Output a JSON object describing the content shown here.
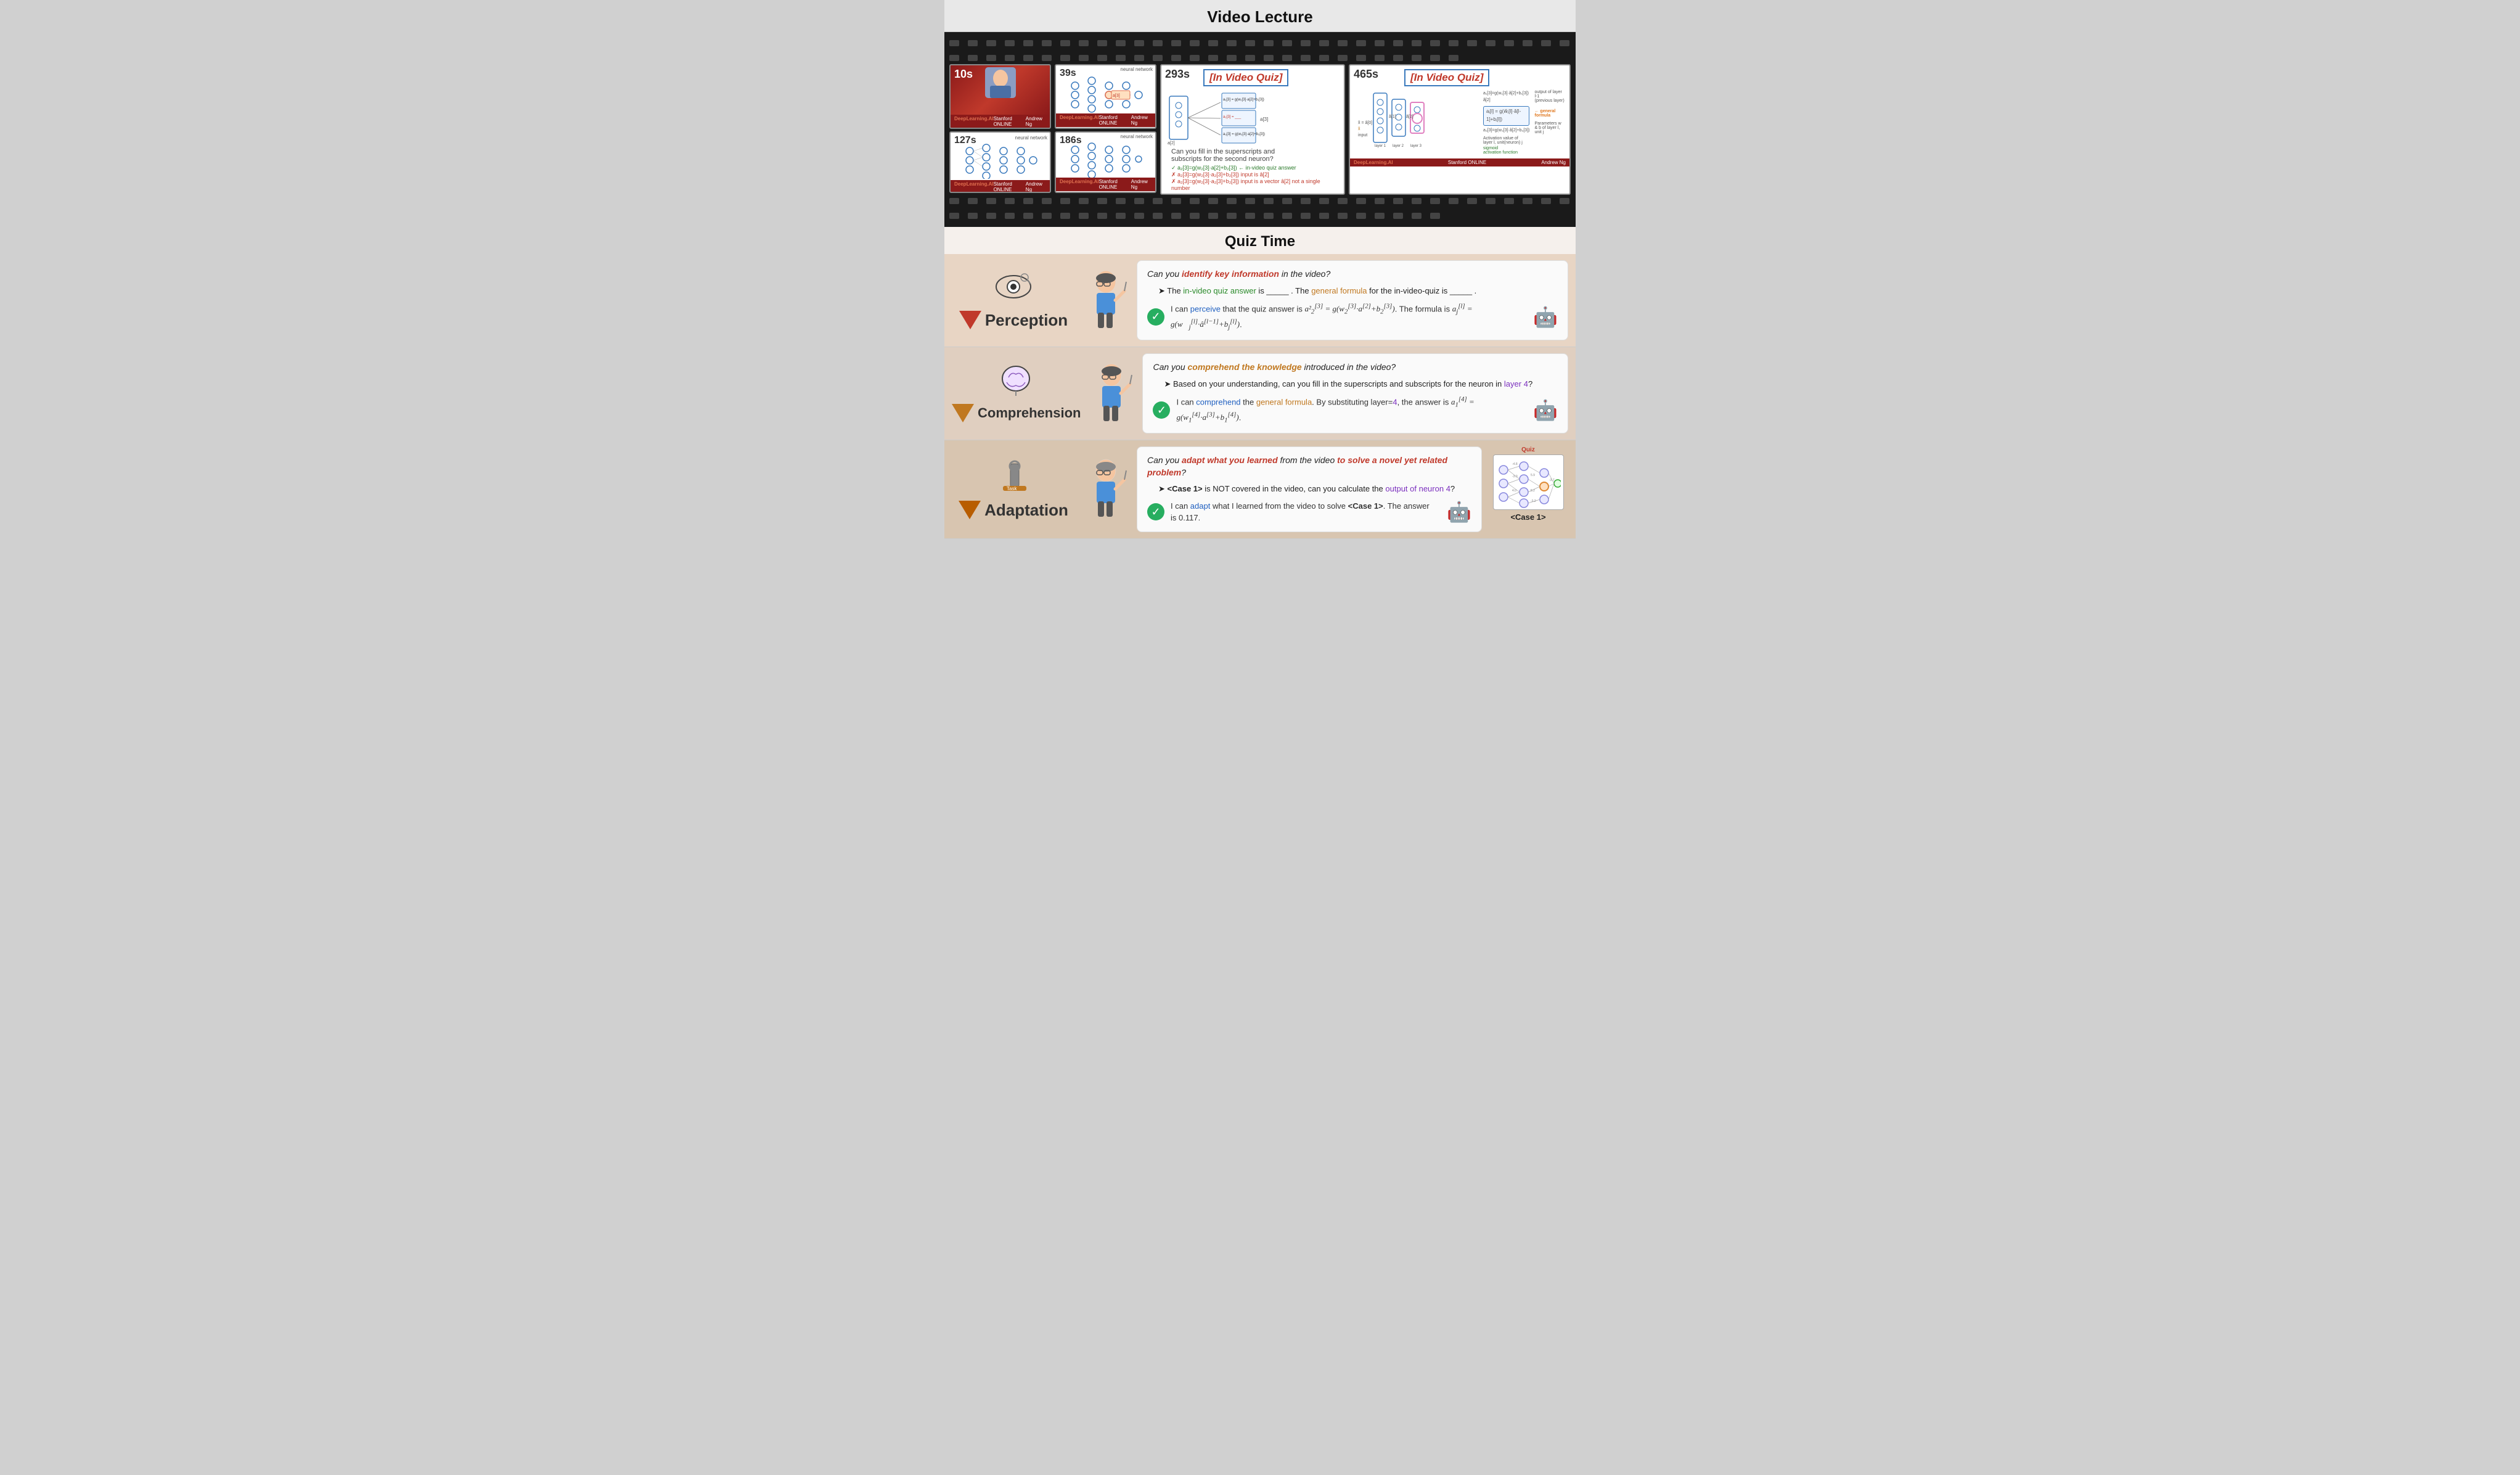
{
  "header": {
    "title": "Video Lecture"
  },
  "film_strip": {
    "frames": [
      {
        "timestamp": "10s",
        "type": "presenter"
      },
      {
        "timestamp": "39s",
        "type": "neural_network",
        "label": "neural network"
      },
      {
        "timestamp": "127s",
        "type": "neural_network",
        "label": "neural network"
      },
      {
        "timestamp": "186s",
        "type": "neural_network",
        "label": "neural network"
      },
      {
        "timestamp": "293s",
        "type": "quiz",
        "quiz_label": "[In Video Quiz]"
      },
      {
        "timestamp": "465s",
        "type": "quiz2",
        "quiz_label": "[In Video Quiz]"
      }
    ],
    "footer": {
      "logo": "DeepLearning.AI",
      "partner": "Stanford ONLINE",
      "instructor": "Andrew Ng"
    }
  },
  "quiz_section": {
    "title": "Quiz Time"
  },
  "levels": [
    {
      "id": "perception",
      "name": "Perception",
      "color": "#c0392b",
      "question_prefix": "Can you ",
      "question_bold": "identify key information",
      "question_suffix": " in the video?",
      "sub_question": "The in-video quiz answer is _____ . The general formula for the in-video-quiz is _____ .",
      "sub_green": "in-video quiz answer",
      "sub_orange": "general formula",
      "sub_blue": "in-video-quiz",
      "answer_perceive": "perceive",
      "answer_text": "I can perceive that the quiz answer is a²[3] = g(w₂[3]·a[2]+b₂[3]). The formula is aⱼ[l] = g(w⃗ⱼ[l]·a⃗[l-1]+bⱼ[l])."
    },
    {
      "id": "comprehension",
      "name": "Comprehension",
      "color": "#c07820",
      "question_prefix": "Can you ",
      "question_bold": "comprehend the knowledge",
      "question_suffix": " introduced in the video?",
      "sub_question": "Based on your understanding, can you fill in the superscripts and subscripts for the neuron in layer 4?",
      "sub_purple": "layer 4",
      "answer_comprehend": "comprehend",
      "answer_orange": "general formula",
      "answer_text": "I can comprehend the general formula. By substituting layer=4, the answer is a₁[4] = g(w₁[4]·a[3]+b₁[4])."
    },
    {
      "id": "adaptation",
      "name": "Adaptation",
      "color": "#b85d00",
      "question_prefix": "Can you ",
      "question_bold1": "adapt what you learned",
      "question_mid": " from the video ",
      "question_bold2": "to solve a novel yet related problem",
      "question_suffix": "?",
      "sub_question": "<Case 1> is NOT covered in the video, can you calculate the output of neuron 4?",
      "sub_purple": "output of neuron 4",
      "answer_adapt": "adapt",
      "answer_text": "I can adapt what I learned from the video to solve <Case 1>. The answer is 0.117.",
      "case_label": "<Case 1>"
    }
  ],
  "icons": {
    "check": "✓",
    "robot": "🤖",
    "perception_icon": "👁",
    "comprehension_icon": "🧠",
    "adaptation_icon": "🔧"
  }
}
